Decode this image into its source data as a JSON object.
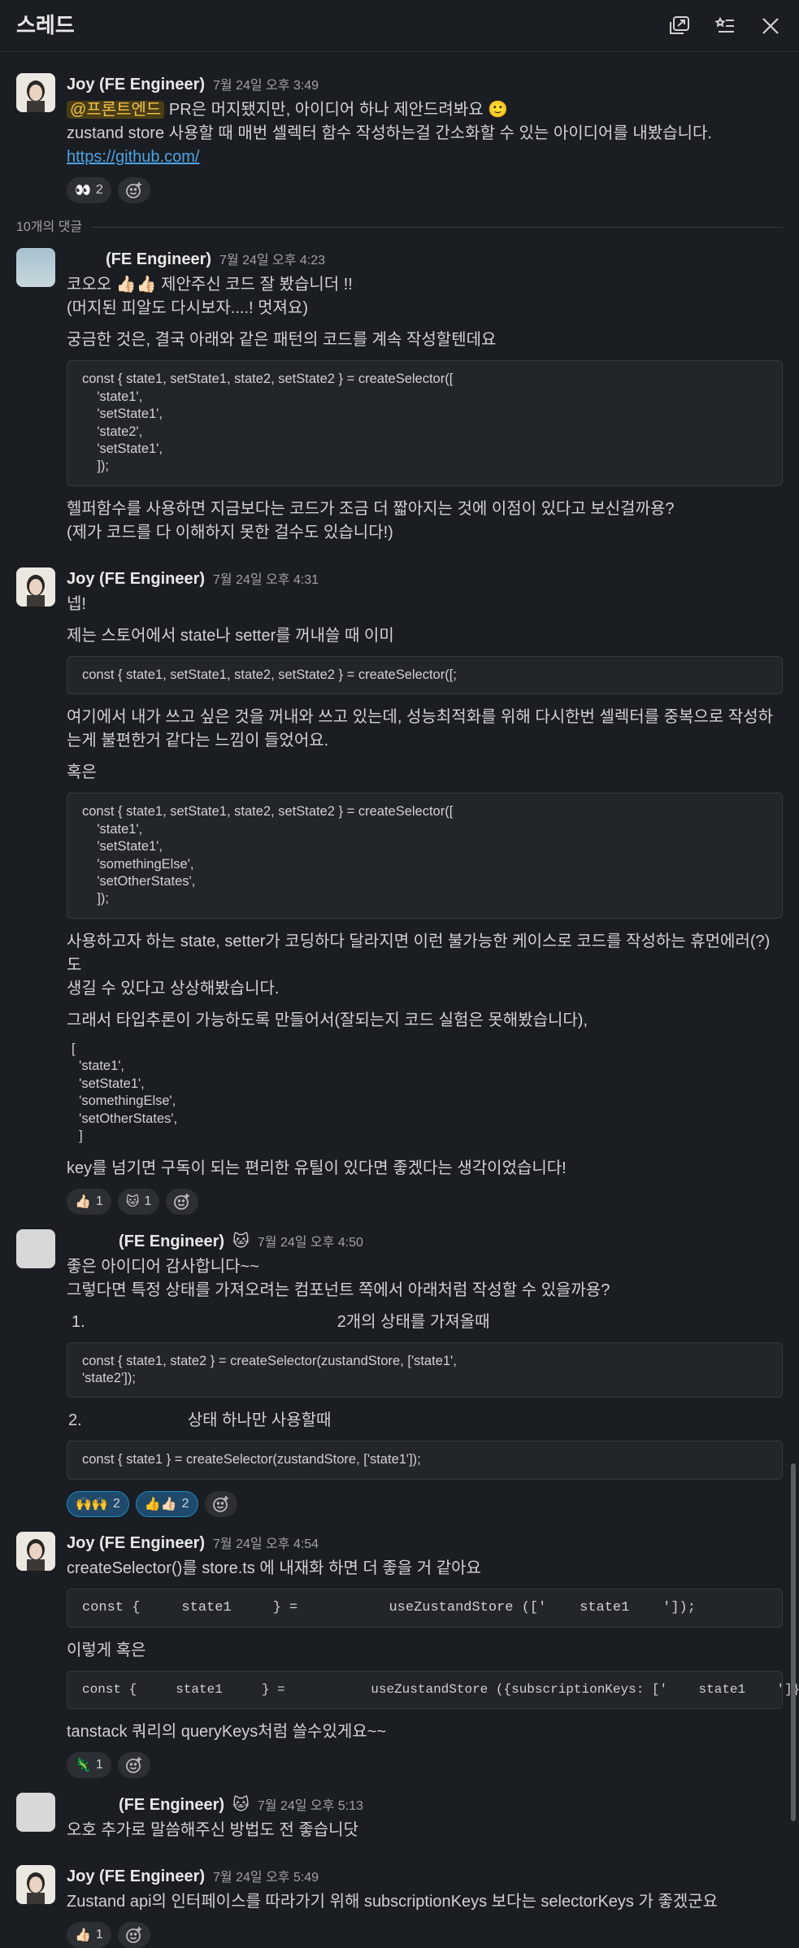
{
  "header": {
    "title": "스레드"
  },
  "root": {
    "author": "Joy (FE Engineer)",
    "time": "7월 24일 오후 3:49",
    "mention": "@프론트엔드",
    "line1": " PR은 머지됐지만, 아이디어 하나 제안드려봐요 🙂",
    "line2": "zustand store 사용할 때 매번 셀렉터 함수 작성하는걸 간소화할 수 있는 아이디어를 내봤습니다.",
    "link": "https://github.com/",
    "reactions": [
      {
        "emoji": "👀",
        "count": "2"
      }
    ]
  },
  "replies_label": "10개의 댓글",
  "r1": {
    "author": "(FE Engineer)",
    "time": "7월 24일 오후 4:23",
    "p1": "코오오 👍🏻👍🏻 제안주신 코드 잘 봤습니더 !!\n(머지된 피알도 다시보자....! 멋져요)",
    "p2": "궁금한 것은, 결국 아래와 같은 패턴의 코드를 계속 작성할텐데요",
    "code": "const { state1, setState1, state2, setState2 } = createSelector([\n    'state1',\n    'setState1',\n    'state2',\n    'setState1',\n    ]);",
    "p3": "헬퍼함수를 사용하면 지금보다는 코드가 조금 더 짧아지는 것에 이점이 있다고 보신걸까용?\n(제가 코드를 다 이해하지 못한 걸수도 있습니다!)"
  },
  "r2": {
    "author": "Joy (FE Engineer)",
    "time": "7월 24일 오후 4:31",
    "p1": "넵!",
    "p2": "제는 스토어에서 state나 setter를 꺼내쓸 때 이미",
    "code1": "const { state1, setState1, state2, setState2 } = createSelector([;",
    "p3": "여기에서 내가 쓰고 싶은 것을 꺼내와 쓰고 있는데, 성능최적화를 위해 다시한번 셀렉터를 중복으로 작성하\n는게 불편한거 같다는 느낌이 들었어요.",
    "p4": "혹은",
    "code2": "const { state1, setState1, state2, setState2 } = createSelector([\n    'state1',\n    'setState1',\n    'somethingElse',\n    'setOtherStates',\n    ]);",
    "p5": "사용하고자 하는 state, setter가 코딩하다 달라지면 이런 불가능한 케이스로 코드를 작성하는 휴먼에러(?)도\n생길 수 있다고 상상해봤습니다.",
    "p6": "그래서 타입추론이 가능하도록 만들어서(잘되는지 코드 실험은 못해봤습니다),",
    "plain": "[\n  'state1',\n  'setState1',\n  'somethingElse',\n  'setOtherStates',\n  ]",
    "p7": "key를 넘기면 구독이 되는 편리한 유틸이 있다면 좋겠다는 생각이었습니다!",
    "reactions": [
      {
        "emoji": "👍🏻",
        "count": "1"
      },
      {
        "emoji": "🐱",
        "count": "1"
      }
    ]
  },
  "r3": {
    "author": "(FE Engineer)",
    "badge": "🐱",
    "time": "7월 24일 오후 4:50",
    "p1": "좋은 아이디어 감사합니다~~\n그렇다면 특정 상태를 가져오려는 컴포넌트 쪽에서 아래처럼 작성할 수 있을까용?",
    "item1_num": "1.",
    "item1": "2개의 상태를 가져올때",
    "code1": "const { state1, state2 } = createSelector(zustandStore, ['state1',\n'state2']);",
    "item2_num": "2.",
    "item2": "상태 하나만 사용할때",
    "code2": "const { state1 } = createSelector(zustandStore, ['state1']);",
    "reactions": [
      {
        "emoji": "🙌🙌",
        "count": "2"
      },
      {
        "emoji": "👍👍🏻",
        "count": "2"
      }
    ]
  },
  "r4": {
    "author": "Joy (FE Engineer)",
    "time": "7월 24일 오후 4:54",
    "p1": "createSelector()를 store.ts 에 내재화 하면 더 좋을 거 같아요",
    "code1": "const {     state1     } =           useZustandStore (['    state1    ']);",
    "p2": "이렇게 혹은",
    "code2": "const {     state1     } =           useZustandStore ({subscriptionKeys: ['    state1    ']});",
    "p3": "tanstack 쿼리의 queryKeys처럼 쓸수있게요~~",
    "reactions": [
      {
        "emoji": "🦎",
        "count": "1"
      }
    ]
  },
  "r5": {
    "author": "(FE Engineer)",
    "badge": "🐱",
    "time": "7월 24일 오후 5:13",
    "p1": "오호 추가로 말씀해주신 방법도 전 좋습니닷"
  },
  "r6": {
    "author": "Joy (FE Engineer)",
    "time": "7월 24일 오후 5:49",
    "p1": "Zustand api의 인터페이스를 따라가기 위해 subscriptionKeys 보다는 selectorKeys 가 좋겠군요",
    "reactions": [
      {
        "emoji": "👍🏻",
        "count": "1"
      }
    ]
  }
}
